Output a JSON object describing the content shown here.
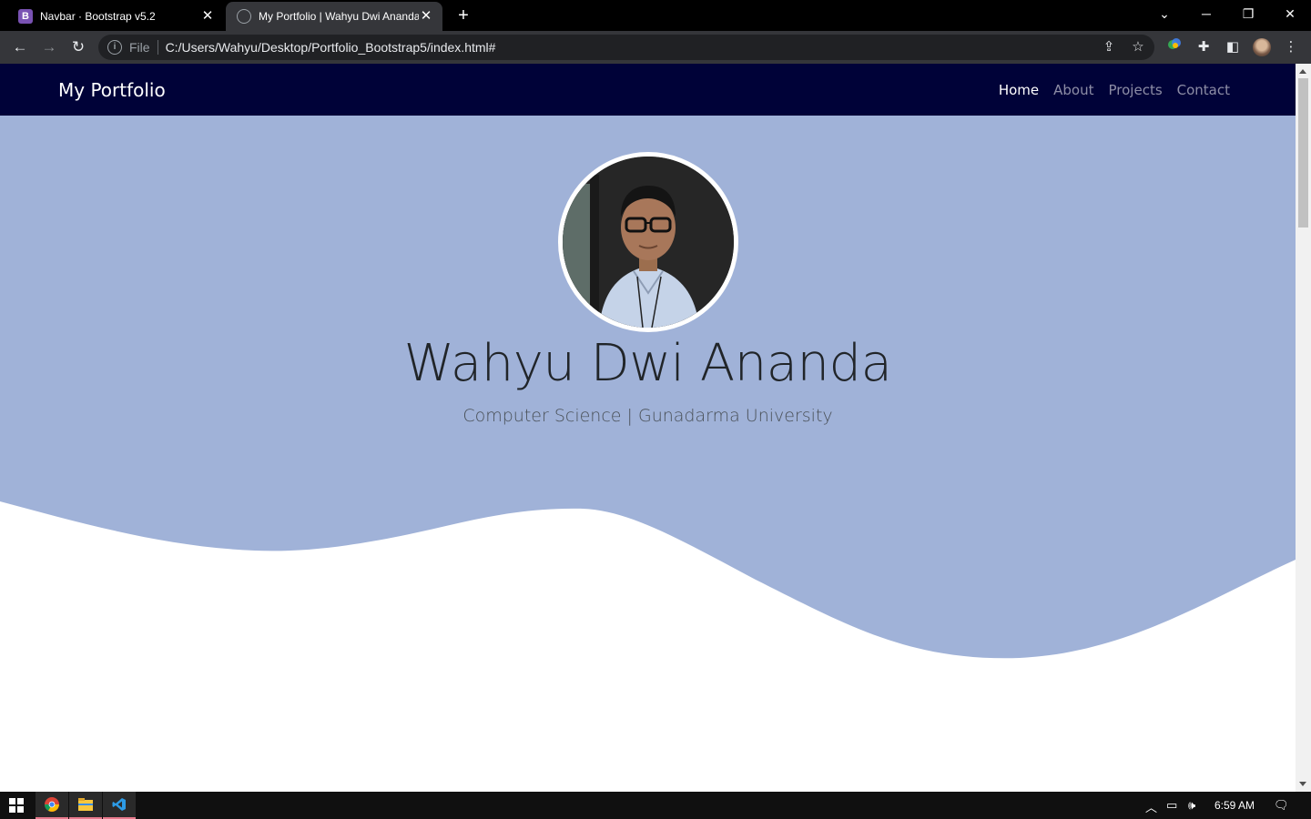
{
  "browser": {
    "tabs": [
      {
        "title": "Navbar · Bootstrap v5.2",
        "icon": "bootstrap-favicon-icon"
      },
      {
        "title": "My Portfolio | Wahyu Dwi Ananda",
        "icon": "globe-icon"
      }
    ],
    "address": {
      "scheme_label": "File",
      "url": "C:/Users/Wahyu/Desktop/Portfolio_Bootstrap5/index.html#"
    }
  },
  "page": {
    "brand": "My Portfolio",
    "nav": [
      {
        "label": "Home",
        "active": true
      },
      {
        "label": "About",
        "active": false
      },
      {
        "label": "Projects",
        "active": false
      },
      {
        "label": "Contact",
        "active": false
      }
    ],
    "hero": {
      "name": "Wahyu Dwi Ananda",
      "subtitle": "Computer Science | Gunadarma University"
    }
  },
  "taskbar": {
    "clock": "6:59 AM",
    "apps": [
      "chrome-icon",
      "file-explorer-icon",
      "vscode-icon"
    ]
  },
  "colors": {
    "navbar": "#000238",
    "hero_bg": "#a0b2d8",
    "chrome_dark": "#35363a"
  }
}
